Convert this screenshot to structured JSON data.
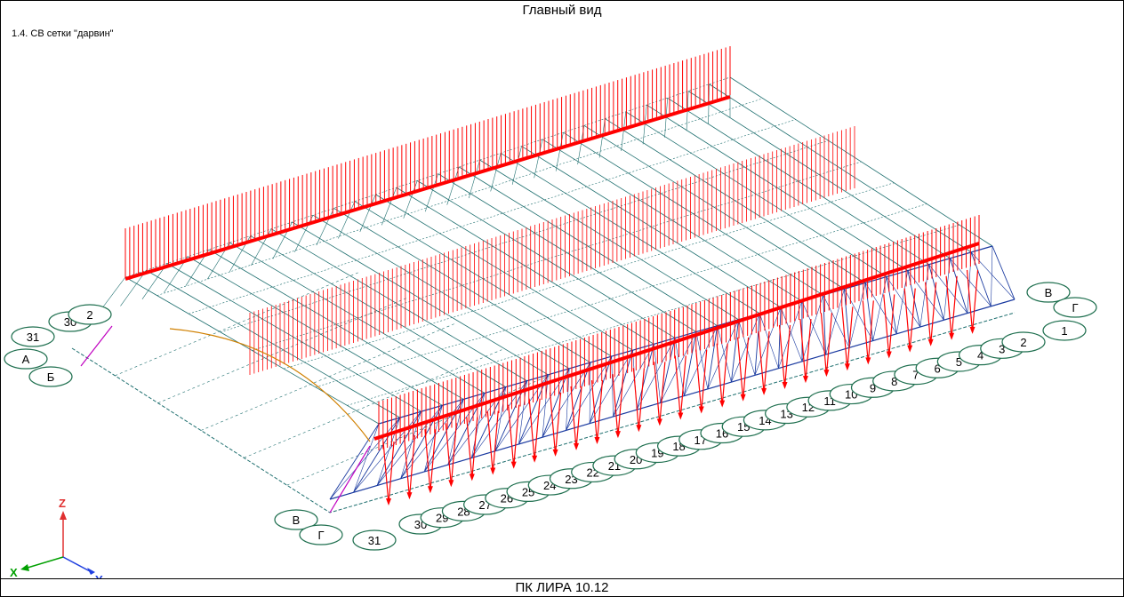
{
  "window": {
    "title": "Главный вид"
  },
  "view": {
    "caption": "1.4. СВ сетки \"дарвин\""
  },
  "status": {
    "text": "ПК ЛИРА 10.12"
  },
  "axes": {
    "x": "X",
    "y": "Y",
    "z": "Z"
  },
  "axes_colors": {
    "x": "#00a000",
    "y": "#2040e0",
    "z": "#e03030"
  },
  "colors": {
    "load": "#ff0000",
    "frame": "#207070",
    "bubble": "#207050",
    "panel": "#1a3aa0"
  },
  "grid_labels": {
    "left_end": [
      "31",
      "30",
      "2",
      "А",
      "Б"
    ],
    "right_end": [
      "В",
      "Г",
      "1"
    ],
    "bottom_corner": [
      "В",
      "Г",
      "31"
    ],
    "front_row": [
      "30",
      "29",
      "28",
      "27",
      "26",
      "25",
      "24",
      "23",
      "22",
      "21",
      "20",
      "19",
      "18",
      "17",
      "16",
      "15",
      "14",
      "13",
      "12",
      "11",
      "10",
      "9",
      "8",
      "7",
      "6",
      "5",
      "4",
      "3",
      "2"
    ]
  }
}
